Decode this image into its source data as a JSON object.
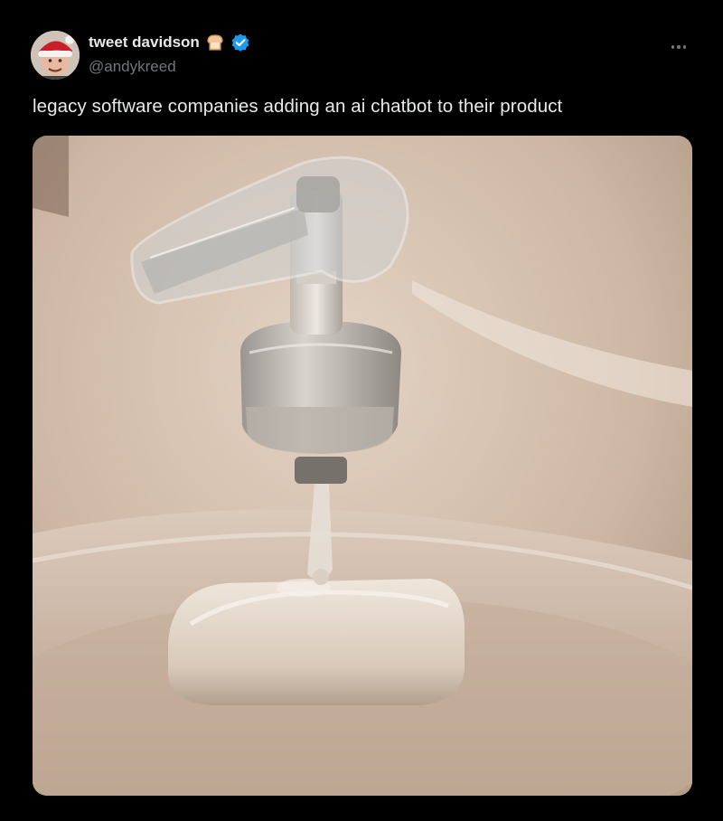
{
  "author": {
    "display_name": "tweet davidson",
    "handle": "@andykreed",
    "avatar": "avatar-man-with-santa-hat",
    "name_emoji": "bread-icon",
    "verified": true,
    "verified_color": "#1d9bf0"
  },
  "tweet": {
    "text": "legacy software companies adding an ai chatbot to their product"
  },
  "media": {
    "subject": "soap-pump-dispensing-onto-bar-of-soap",
    "background_color": "#c9b4a2"
  },
  "colors": {
    "background": "#000000",
    "text_primary": "#e7e9ea",
    "text_secondary": "#71767b"
  }
}
